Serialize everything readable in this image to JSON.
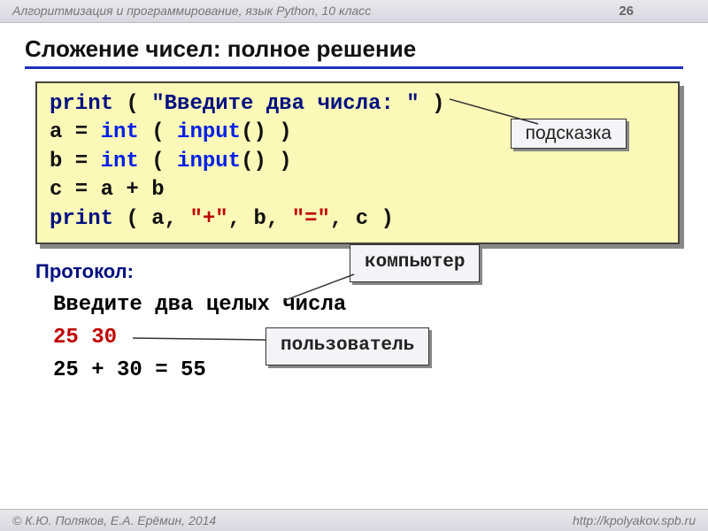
{
  "header": {
    "course": "Алгоритмизация и программирование, язык Python, 10 класс",
    "page": "26"
  },
  "title": "Сложение чисел: полное решение",
  "code": {
    "l1": {
      "fn": "print",
      "lp": " ( ",
      "str": "\"Введите два числа: \"",
      "rp": " )"
    },
    "l2": {
      "lhs": "a = ",
      "int": "int",
      "mid": " ( ",
      "inp": "input",
      "rp": "() )"
    },
    "l3": {
      "lhs": "b = ",
      "int": "int",
      "mid": " ( ",
      "inp": "input",
      "rp": "() )"
    },
    "l4": "c = a + b",
    "l5": {
      "fn": "print",
      "lp": " ( ",
      "args_a": "a, ",
      "q1": "\"+\"",
      "args_b": ", b, ",
      "q2": "\"=\"",
      "args_c": ", c ",
      "rp": ")"
    }
  },
  "callouts": {
    "hint": "подсказка",
    "computer": "компьютер",
    "user": "пользователь"
  },
  "protocol": {
    "label": "Протокол:",
    "line1": "Введите два целых числа",
    "line2": "25 30",
    "line3": "25 + 30 = 55"
  },
  "footer": {
    "left": "© К.Ю. Поляков, Е.А. Ерёмин, 2014",
    "right": "http://kpolyakov.spb.ru"
  }
}
